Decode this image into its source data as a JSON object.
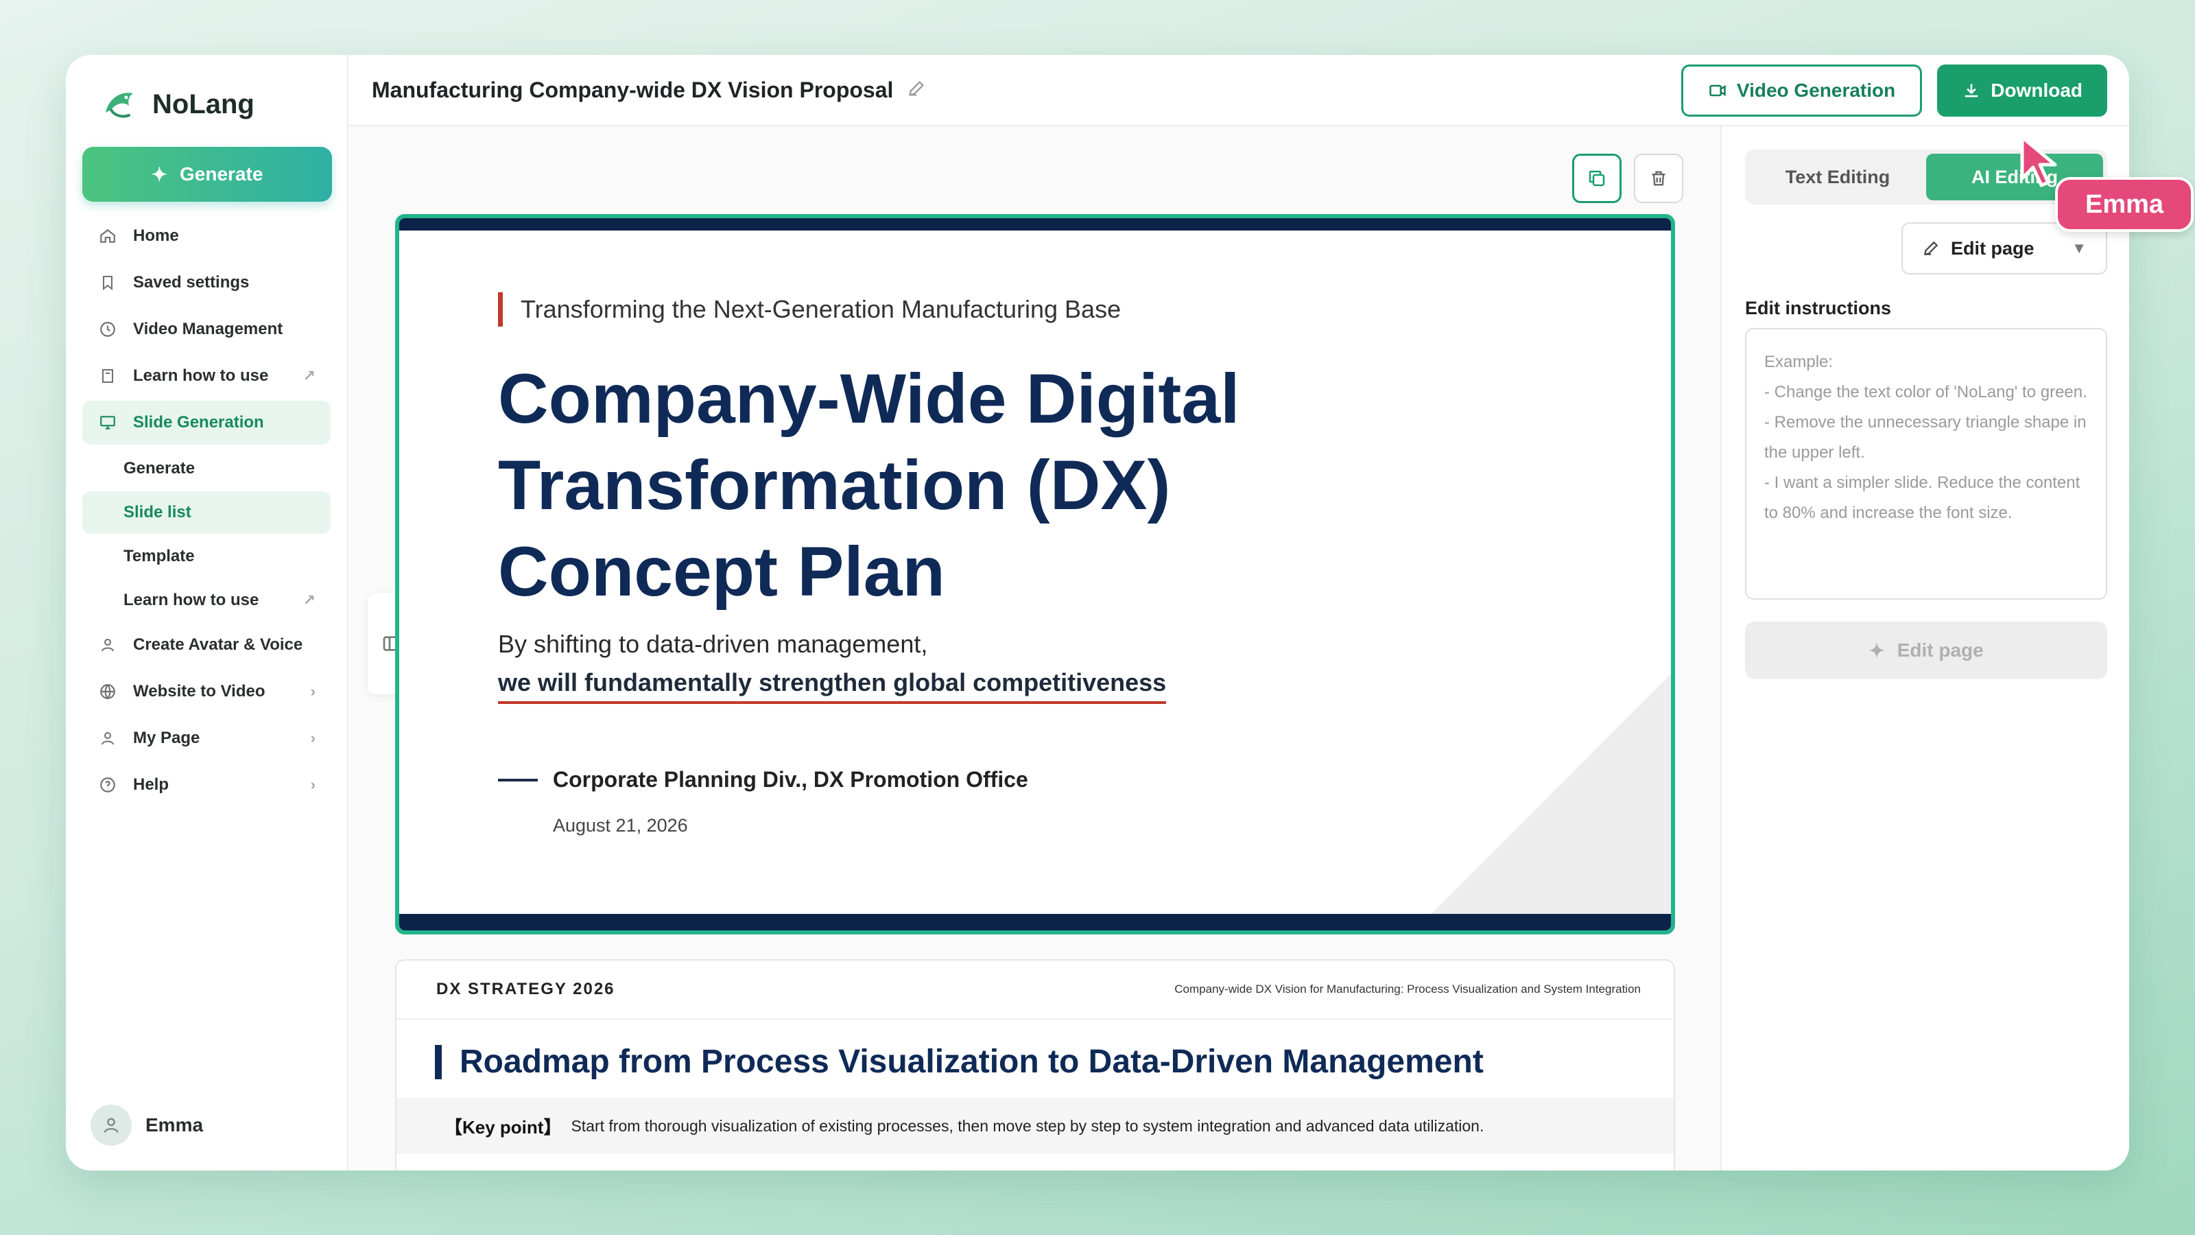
{
  "app": {
    "name": "NoLang",
    "brand_color": "#1a9e6c"
  },
  "sidebar": {
    "generate_label": "Generate",
    "items": [
      {
        "label": "Home",
        "icon": "home-icon"
      },
      {
        "label": "Saved settings",
        "icon": "bookmark-icon"
      },
      {
        "label": "Video Management",
        "icon": "clock-icon"
      },
      {
        "label": "Learn how to use",
        "icon": "book-icon",
        "trail": "↗"
      },
      {
        "label": "Slide Generation",
        "icon": "monitor-icon",
        "active": true
      }
    ],
    "sub_items": [
      {
        "label": "Generate"
      },
      {
        "label": "Slide list",
        "active": true
      },
      {
        "label": "Template"
      },
      {
        "label": "Learn how to use",
        "trail": "↗"
      }
    ],
    "items_after": [
      {
        "label": "Create Avatar & Voice",
        "icon": "person-icon"
      },
      {
        "label": "Website to Video",
        "icon": "globe-icon",
        "trail": "›"
      },
      {
        "label": "My Page",
        "icon": "person-icon",
        "trail": "›"
      },
      {
        "label": "Help",
        "icon": "help-icon",
        "trail": "›"
      }
    ],
    "user_name": "Emma"
  },
  "topbar": {
    "title": "Manufacturing Company-wide DX Vision Proposal",
    "video_generation_label": "Video Generation",
    "download_label": "Download"
  },
  "slide1": {
    "kicker": "Transforming the Next-Generation Manufacturing Base",
    "title_line1": "Company-Wide Digital",
    "title_line2": "Transformation (DX)",
    "title_line3": "Concept Plan",
    "sub1": "By shifting to data-driven management,",
    "sub2": "we will fundamentally strengthen global competitiveness",
    "dept": "Corporate Planning Div., DX Promotion Office",
    "date": "August 21, 2026"
  },
  "slide2": {
    "tag": "DX STRATEGY 2026",
    "meta": "Company-wide DX Vision for Manufacturing: Process Visualization and System Integration",
    "title": "Roadmap from Process Visualization to Data-Driven Management",
    "key_label": "【Key point】",
    "key_text": "Start from thorough visualization of existing processes, then move step by step to system integration and advanced data utilization."
  },
  "right_panel": {
    "tab_text": "Text Editing",
    "tab_ai": "AI Editing",
    "mode_label": "Edit page",
    "instructions_label": "Edit instructions",
    "instructions_placeholder": "Example:\n- Change the text color of 'NoLang' to green.\n- Remove the unnecessary triangle shape in the upper left.\n- I want a simpler slide. Reduce the content to 80% and increase the font size.",
    "edit_button": "Edit page"
  },
  "cursor": {
    "user_label": "Emma",
    "color": "#e5497a"
  }
}
